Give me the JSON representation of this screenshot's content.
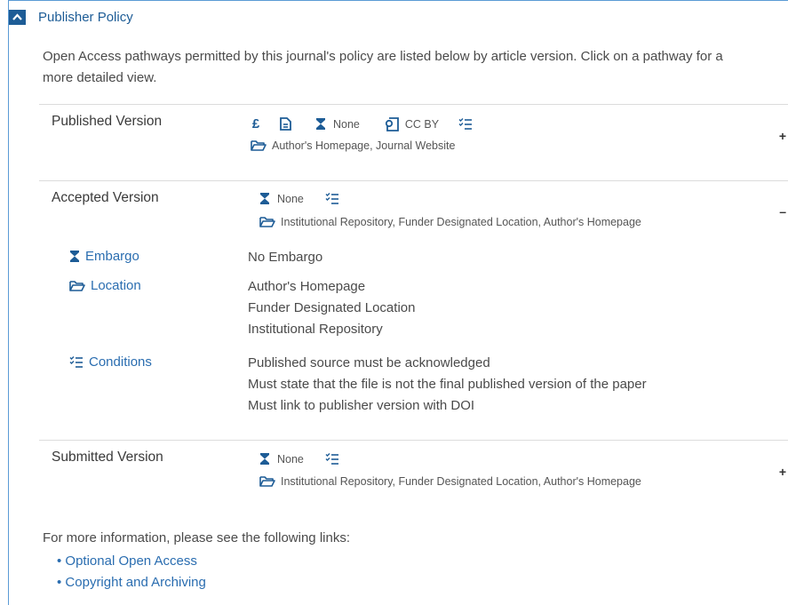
{
  "panel": {
    "title": "Publisher Policy",
    "intro_line1": "Open Access pathways permitted by this journal's policy are listed below by article version. Click on a pathway for a",
    "intro_line2": "more detailed view."
  },
  "published": {
    "name": "Published Version",
    "pound": "£",
    "embargo": "None",
    "license": "CC BY",
    "locations": "Author's Homepage, Journal Website",
    "toggle": "+"
  },
  "accepted": {
    "name": "Accepted Version",
    "embargo": "None",
    "locations": "Institutional Repository, Funder Designated Location, Author's Homepage",
    "toggle": "–",
    "details": {
      "embargo_label": "Embargo",
      "embargo_value": "No Embargo",
      "location_label": "Location",
      "locations": [
        "Author's Homepage",
        "Funder Designated Location",
        "Institutional Repository"
      ],
      "conditions_label": "Conditions",
      "conditions": [
        "Published source must be acknowledged",
        "Must state that the file is not the final published version of the paper",
        "Must link to publisher version with DOI"
      ]
    }
  },
  "submitted": {
    "name": "Submitted Version",
    "embargo": "None",
    "locations": "Institutional Repository, Funder Designated Location, Author's Homepage",
    "toggle": "+"
  },
  "footer": {
    "text": "For more information, please see the following links:",
    "links": [
      "Optional Open Access",
      "Copyright and Archiving"
    ]
  },
  "colors": {
    "accent": "#1d5c96",
    "link": "#2a6db0",
    "frame": "#5b9bd5"
  },
  "icons": [
    "chevron-up-icon",
    "pound-icon",
    "document-icon",
    "hourglass-icon",
    "license-icon",
    "checklist-icon",
    "folder-icon"
  ]
}
